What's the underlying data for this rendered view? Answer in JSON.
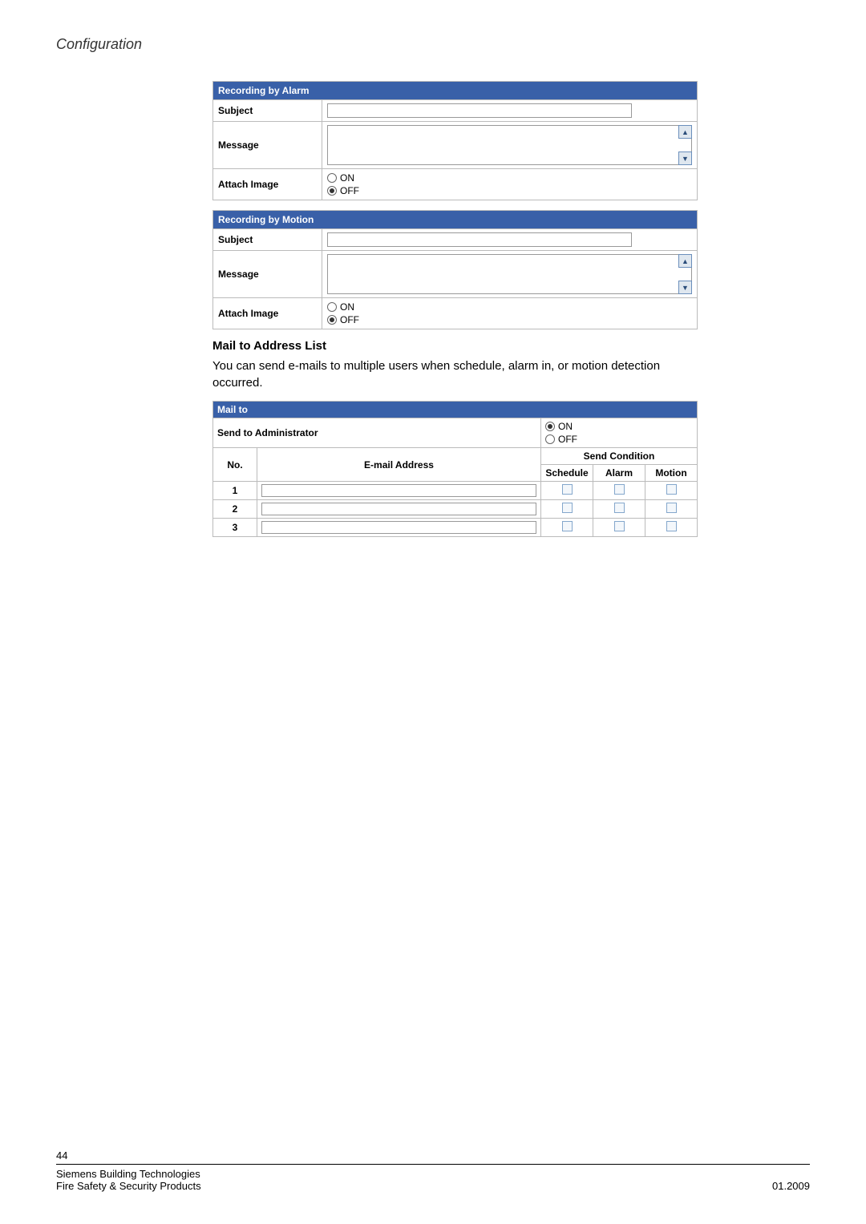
{
  "header": {
    "title": "Configuration"
  },
  "alarm": {
    "title": "Recording by Alarm",
    "labels": {
      "subject": "Subject",
      "message": "Message",
      "attach": "Attach Image"
    },
    "subject_value": "",
    "message_value": "",
    "attach_options": {
      "on": "ON",
      "off": "OFF"
    },
    "attach_selected": "off"
  },
  "motion": {
    "title": "Recording by Motion",
    "labels": {
      "subject": "Subject",
      "message": "Message",
      "attach": "Attach Image"
    },
    "subject_value": "",
    "message_value": "",
    "attach_options": {
      "on": "ON",
      "off": "OFF"
    },
    "attach_selected": "off"
  },
  "mailto_section": {
    "heading": "Mail to Address List",
    "description": "You can send e-mails to multiple users when schedule, alarm in, or motion detection occurred.",
    "table": {
      "title": "Mail to",
      "send_admin_label": "Send to Administrator",
      "send_admin_options": {
        "on": "ON",
        "off": "OFF"
      },
      "send_admin_selected": "on",
      "columns": {
        "no": "No.",
        "email": "E-mail Address",
        "send_cond": "Send Condition",
        "schedule": "Schedule",
        "alarm": "Alarm",
        "motion": "Motion"
      },
      "rows": [
        {
          "no": "1",
          "email": "",
          "schedule": false,
          "alarm": false,
          "motion": false
        },
        {
          "no": "2",
          "email": "",
          "schedule": false,
          "alarm": false,
          "motion": false
        },
        {
          "no": "3",
          "email": "",
          "schedule": false,
          "alarm": false,
          "motion": false
        }
      ]
    }
  },
  "footer": {
    "page": "44",
    "line1": "Siemens Building Technologies",
    "line2_left": "Fire Safety & Security Products",
    "line2_right": "01.2009"
  }
}
